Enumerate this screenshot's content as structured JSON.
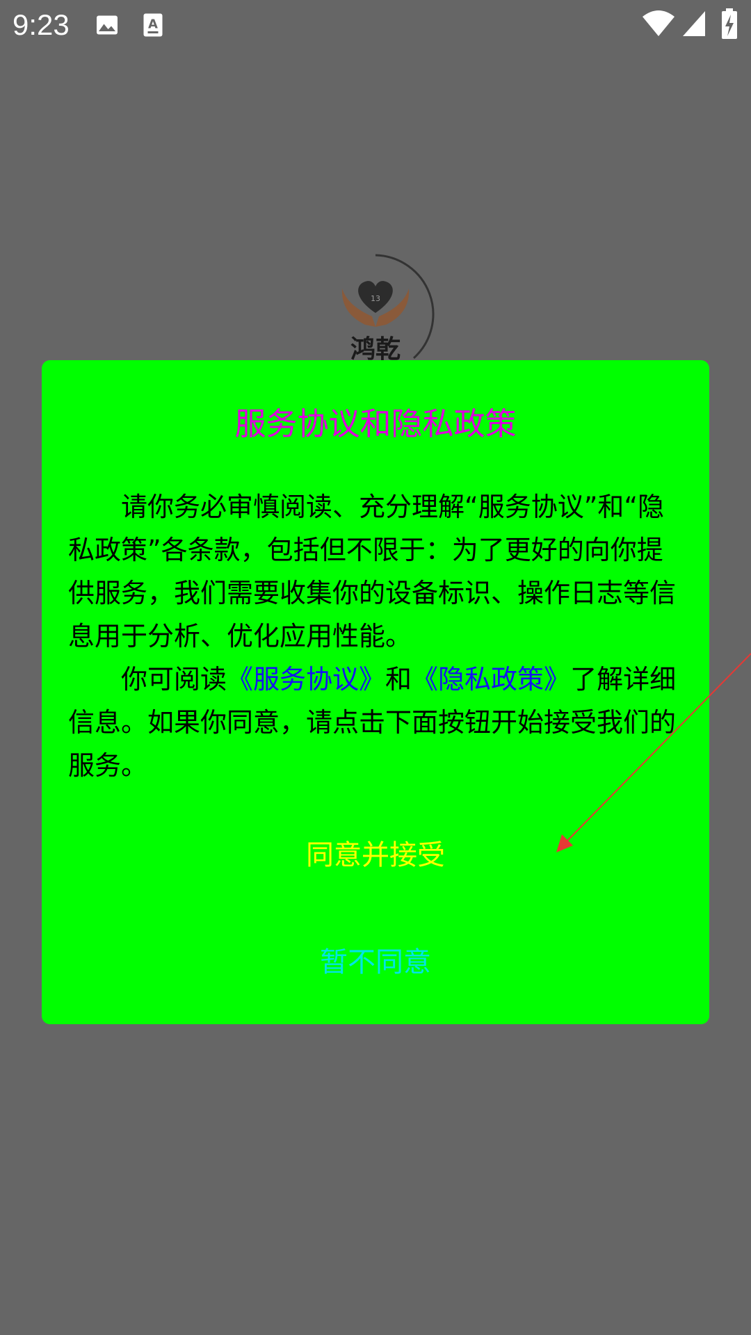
{
  "status_bar": {
    "time": "9:23",
    "icons": [
      "image-icon",
      "keyboard-a-icon",
      "wifi-icon",
      "signal-icon",
      "battery-charging-icon"
    ]
  },
  "splash": {
    "logo_badge": "13",
    "logo_text": "鸿乾"
  },
  "dialog": {
    "title": "服务协议和隐私政策",
    "paragraph1": "请你务必审慎阅读、充分理解“服务协议”和“隐私政策”各条款，包括但不限于：为了更好的向你提供服务，我们需要收集你的设备标识、操作日志等信息用于分析、优化应用性能。",
    "p2_prefix": "你可阅读",
    "link_service": "《服务协议》",
    "p2_and": "和",
    "link_privacy": "《隐私政策》",
    "p2_suffix": "了解详细信息。如果你同意，请点击下面按钮开始接受我们的服务。",
    "agree_label": "同意并接受",
    "disagree_label": "暂不同意"
  },
  "colors": {
    "background": "#666666",
    "dialog_bg": "#00ff00",
    "title": "#dd00dd",
    "link": "#1515ee",
    "agree": "#ffff00",
    "disagree": "#00e5e5",
    "arrow": "#e53935"
  }
}
